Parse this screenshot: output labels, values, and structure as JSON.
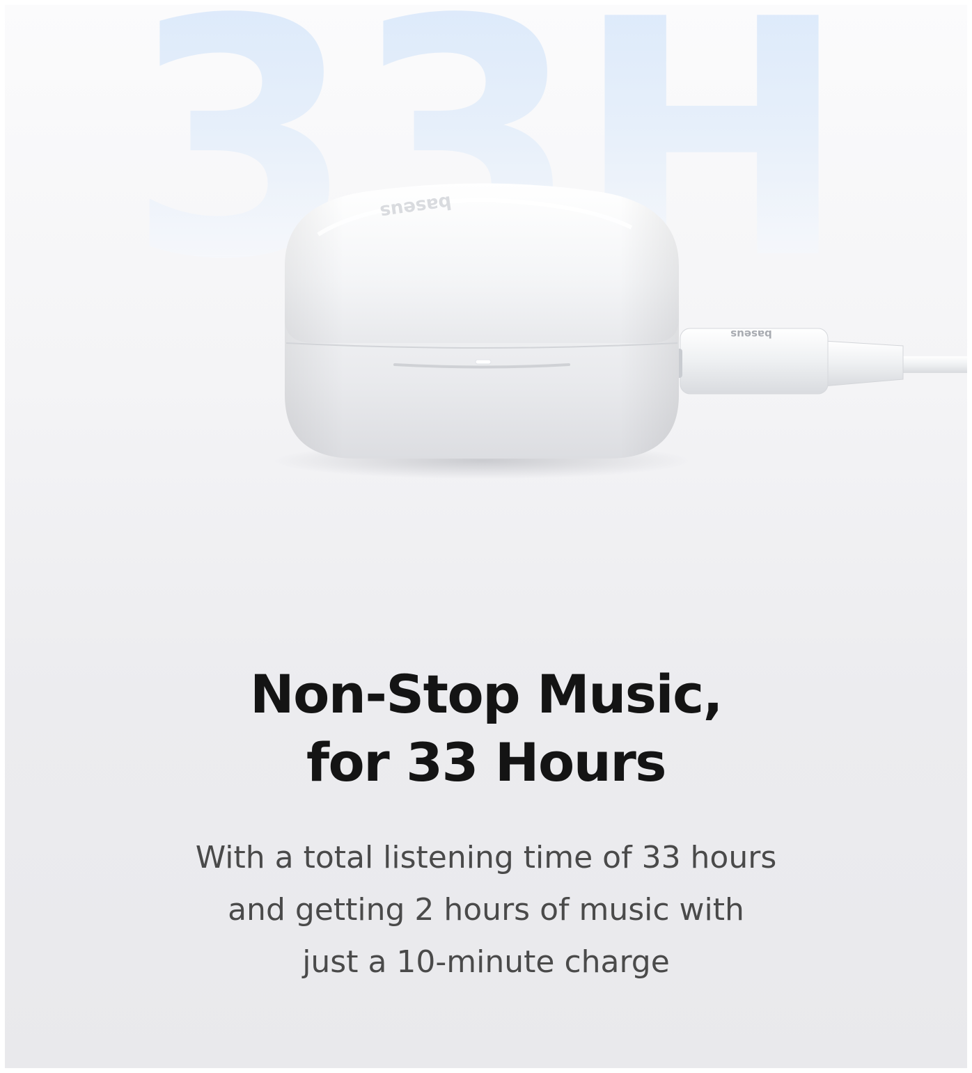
{
  "watermark": {
    "text": "33H"
  },
  "product": {
    "case_logo": "baseus",
    "cable_logo": "baseus",
    "icons": [
      "earbuds-case-icon",
      "usb-c-cable-icon"
    ]
  },
  "headline": {
    "line1": "Non-Stop Music,",
    "line2": "for 33 Hours"
  },
  "description": {
    "line1": "With a total listening time of 33 hours",
    "line2": "and getting 2 hours of music with",
    "line3": "just a 10-minute charge"
  },
  "colors": {
    "headline": "#141414",
    "body": "#4a4a4a",
    "watermark": "#dbe9fb",
    "background": "#f0f0f2"
  }
}
